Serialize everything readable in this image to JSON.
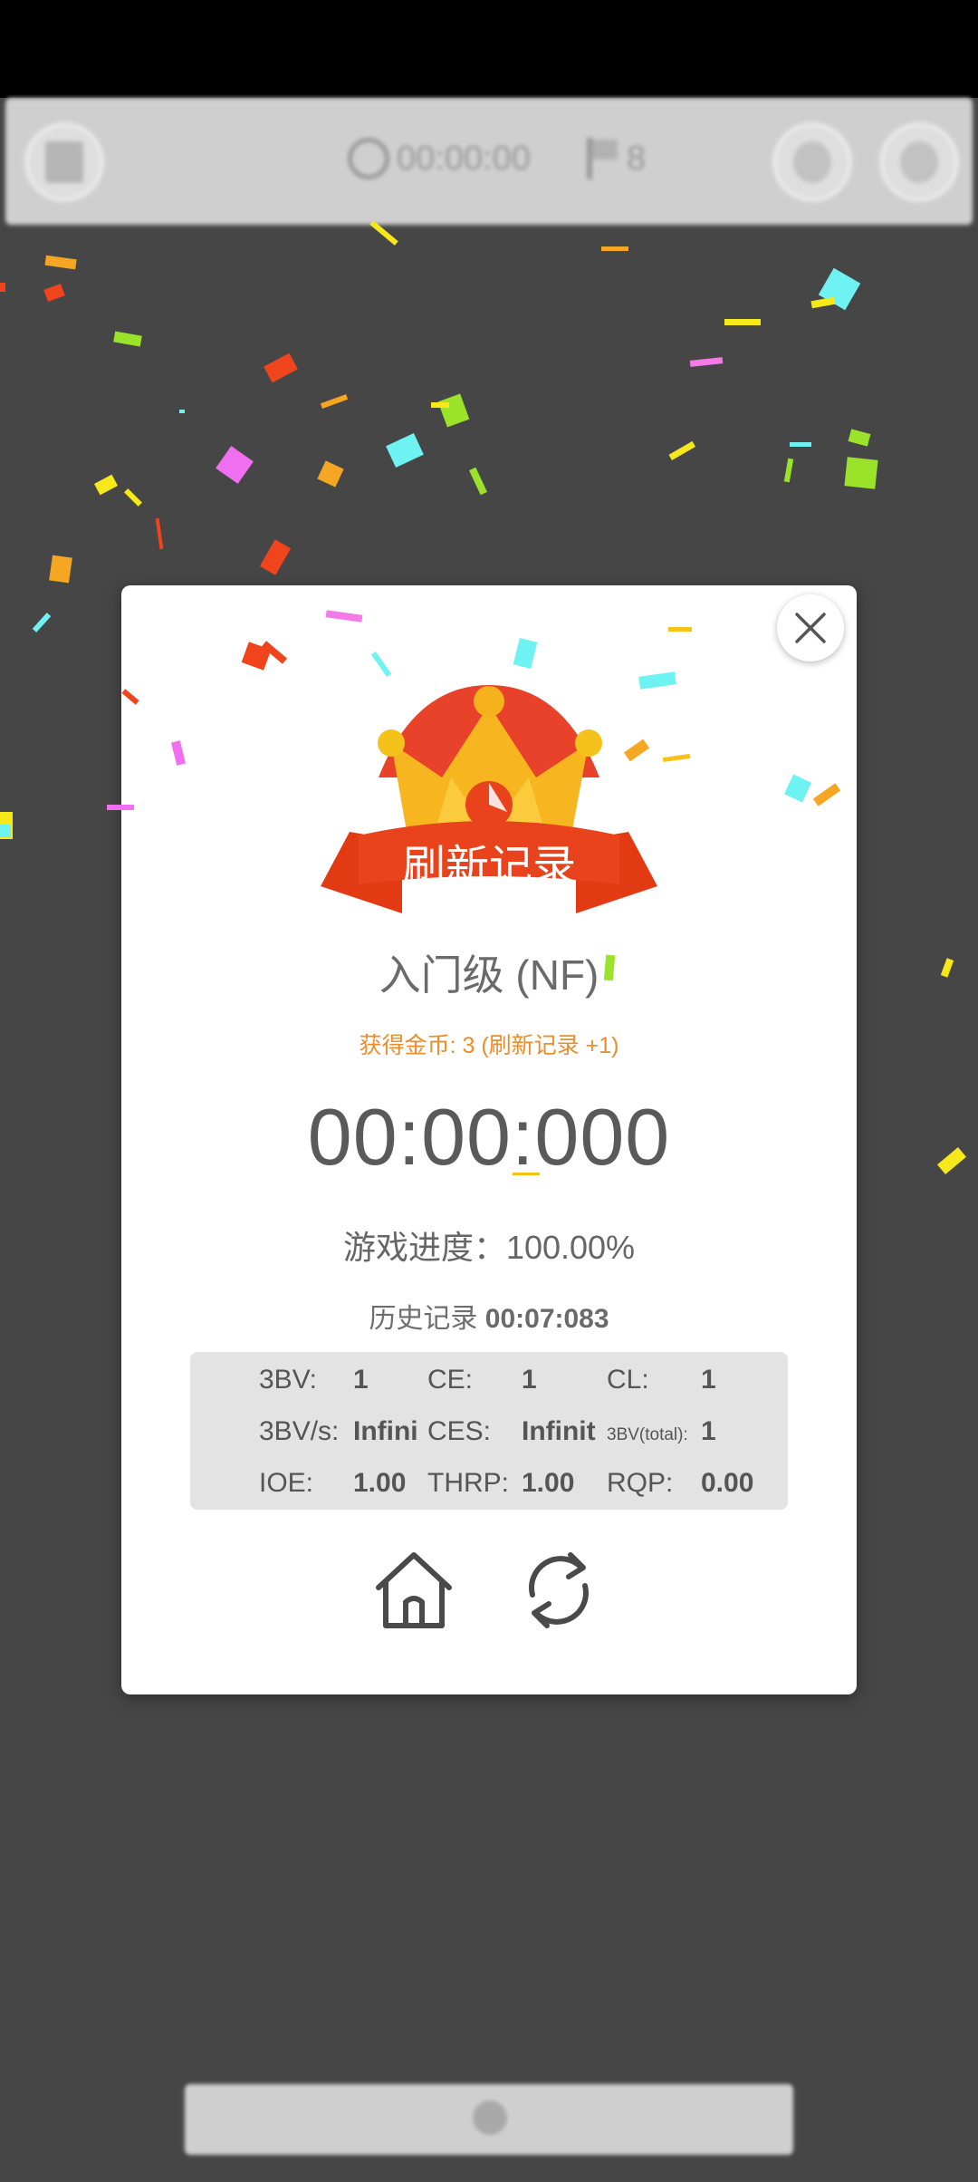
{
  "toolbar": {
    "timer": "00:00:00",
    "flag_count": "8"
  },
  "dialog": {
    "banner_text": "刷新记录",
    "level_title": "入门级 (NF)",
    "coins_text": "获得金币: 3 (刷新记录 +1)",
    "time": "00:00:000",
    "progress_text": "游戏进度：100.00%",
    "history_label": "历史记录",
    "history_value": "00:07:083",
    "stats": {
      "bv_label": "3BV:",
      "bv_value": "1",
      "ce_label": "CE:",
      "ce_value": "1",
      "cl_label": "CL:",
      "cl_value": "1",
      "bvs_label": "3BV/s:",
      "bvs_value": "Infini",
      "ces_label": "CES:",
      "ces_value": "Infinit",
      "bvtotal_label": "3BV(total):",
      "bvtotal_value": "1",
      "ioe_label": "IOE:",
      "ioe_value": "1.00",
      "thrp_label": "THRP:",
      "thrp_value": "1.00",
      "rqp_label": "RQP:",
      "rqp_value": "0.00"
    },
    "icons": {
      "close": "close-icon",
      "home": "home-icon",
      "restart": "restart-icon"
    }
  },
  "colors": {
    "background": "#464646",
    "dialog": "#ffffff",
    "accent_orange": "#ec8d2a",
    "banner_red": "#e8431c",
    "crown_gold": "#f5b21c",
    "stats_panel": "#e3e3e3"
  }
}
